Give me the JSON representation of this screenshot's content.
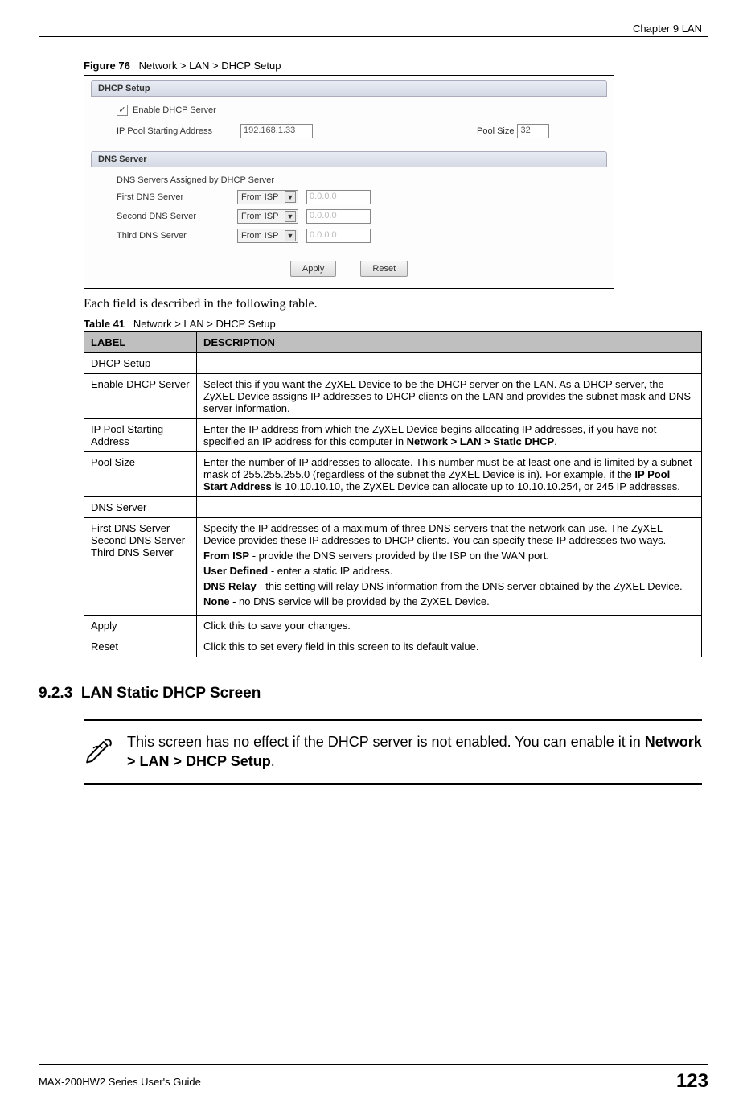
{
  "header": {
    "running": "Chapter 9 LAN"
  },
  "figure": {
    "label": "Figure 76",
    "caption": "Network > LAN > DHCP Setup"
  },
  "screenshot": {
    "panels": {
      "dhcp": {
        "title": "DHCP Setup",
        "enable_label": "Enable DHCP Server",
        "enable_checked": "✓",
        "ip_pool_label": "IP Pool Starting Address",
        "ip_pool_value": "192.168.1.33",
        "pool_size_label": "Pool Size",
        "pool_size_value": "32"
      },
      "dns": {
        "title": "DNS Server",
        "subhead": "DNS Servers Assigned by DHCP Server",
        "rows": [
          {
            "label": "First DNS Server",
            "select": "From ISP",
            "value": "0.0.0.0"
          },
          {
            "label": "Second DNS Server",
            "select": "From ISP",
            "value": "0.0.0.0"
          },
          {
            "label": "Third DNS Server",
            "select": "From ISP",
            "value": "0.0.0.0"
          }
        ]
      }
    },
    "buttons": {
      "apply": "Apply",
      "reset": "Reset"
    }
  },
  "body_text": "Each field is described in the following table.",
  "table": {
    "label": "Table 41",
    "caption": "Network > LAN > DHCP Setup",
    "headers": {
      "label": "LABEL",
      "desc": "DESCRIPTION"
    },
    "rows": {
      "r0": {
        "label": "DHCP Setup",
        "desc": ""
      },
      "r1": {
        "label": "Enable DHCP Server",
        "desc": "Select this if you want the ZyXEL Device to be the DHCP server on the LAN. As a DHCP server, the ZyXEL Device assigns IP addresses to DHCP clients on the LAN and provides the subnet mask and DNS server information."
      },
      "r2": {
        "label": "IP Pool Starting Address",
        "desc_pre": "Enter the IP address from which the ZyXEL Device begins allocating IP addresses, if you have not specified an IP address for this computer in ",
        "desc_bold": "Network > LAN > Static DHCP",
        "desc_post": "."
      },
      "r3": {
        "label": "Pool Size",
        "desc_pre": "Enter the number of IP addresses to allocate. This number must be at least one and is limited by a subnet mask of 255.255.255.0 (regardless of the subnet the ZyXEL Device is in). For example, if the ",
        "desc_bold": "IP Pool Start Address",
        "desc_post": " is 10.10.10.10, the ZyXEL Device can allocate up to 10.10.10.254, or 245 IP addresses."
      },
      "r4": {
        "label": "DNS Server",
        "desc": ""
      },
      "r5": {
        "labels": {
          "l1": "First DNS Server",
          "l2": "Second DNS Server",
          "l3": "Third DNS Server"
        },
        "p1": "Specify the IP addresses of a maximum of three DNS servers that the network can use. The ZyXEL Device provides these IP addresses to DHCP clients. You can specify these IP addresses two ways.",
        "opt1_b": "From ISP",
        "opt1_t": " - provide the DNS servers provided by the ISP on the WAN port.",
        "opt2_b": "User Defined",
        "opt2_t": " - enter a static IP address.",
        "opt3_b": "DNS Relay",
        "opt3_t": " - this setting will relay DNS information from the DNS server obtained by the ZyXEL Device.",
        "opt4_b": "None",
        "opt4_t": " -  no DNS service will be provided by the ZyXEL Device."
      },
      "r6": {
        "label": "Apply",
        "desc": "Click this to save your changes."
      },
      "r7": {
        "label": "Reset",
        "desc": "Click this to set every field in this screen to its default value."
      }
    }
  },
  "section": {
    "number": "9.2.3",
    "title": "LAN Static DHCP Screen"
  },
  "note": {
    "pre": "This screen has no effect if the DHCP server is not enabled. You can enable it in ",
    "bold": "Network > LAN > DHCP Setup",
    "post": "."
  },
  "footer": {
    "guide": "MAX-200HW2 Series User's Guide",
    "page": "123"
  }
}
